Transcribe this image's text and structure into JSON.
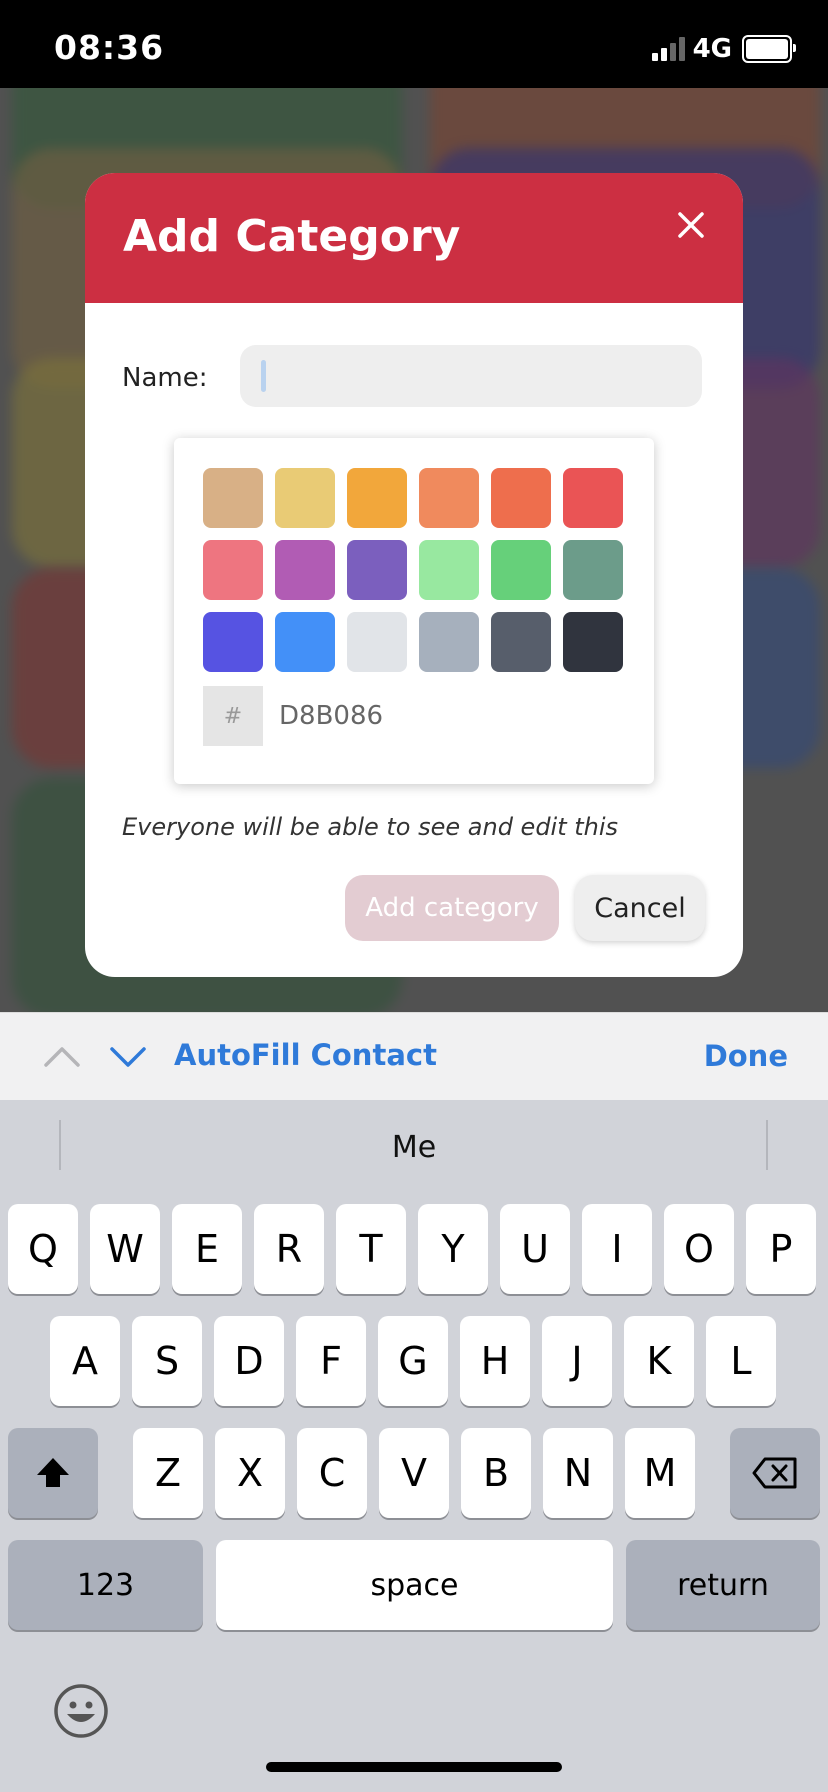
{
  "status_bar": {
    "time": "08:36",
    "network": "4G"
  },
  "modal": {
    "title": "Add Category",
    "name_label": "Name:",
    "name_value": "",
    "swatches": [
      "#D8B086",
      "#E9CB75",
      "#F2A73B",
      "#F08A5D",
      "#EE6E4D",
      "#EA5455",
      "#EE7580",
      "#B15CB4",
      "#7B5FBE",
      "#98E8A0",
      "#66D07A",
      "#6C9C8A",
      "#5653E2",
      "#4390F8",
      "#E1E4E8",
      "#A6B0BD",
      "#575E6B",
      "#30343E"
    ],
    "hex_symbol": "#",
    "hex_value": "D8B086",
    "note": "Everyone will be able to see and edit this",
    "add_button": "Add category",
    "cancel_button": "Cancel"
  },
  "accessory": {
    "autofill": "AutoFill Contact",
    "done": "Done"
  },
  "keyboard": {
    "suggestion": "Me",
    "row1": [
      "Q",
      "W",
      "E",
      "R",
      "T",
      "Y",
      "U",
      "I",
      "O",
      "P"
    ],
    "row2": [
      "A",
      "S",
      "D",
      "F",
      "G",
      "H",
      "J",
      "K",
      "L"
    ],
    "row3": [
      "Z",
      "X",
      "C",
      "V",
      "B",
      "N",
      "M"
    ],
    "numbers_key": "123",
    "space_key": "space",
    "return_key": "return"
  },
  "colors": {
    "accent": "#CC2F42",
    "link": "#2F7AD9"
  }
}
